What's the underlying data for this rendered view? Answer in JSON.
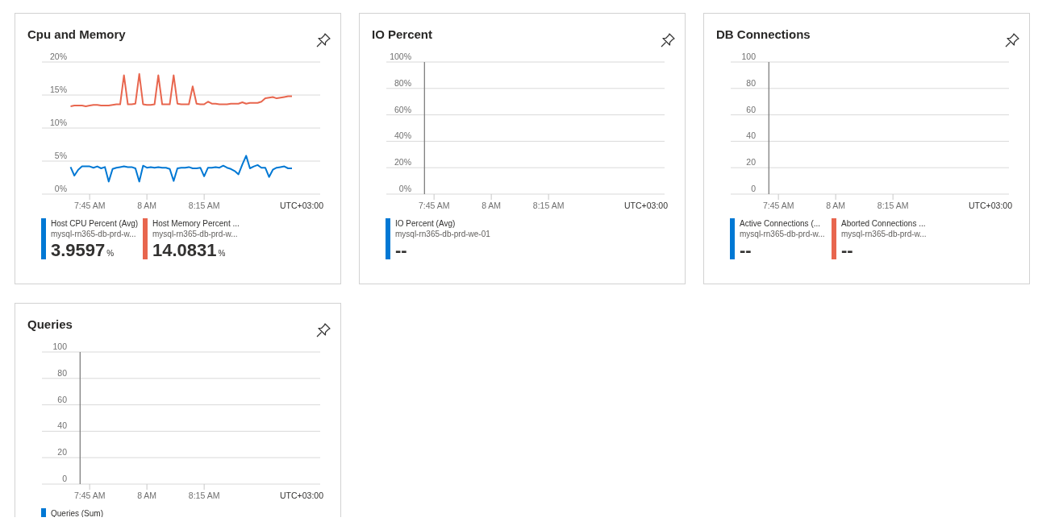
{
  "cards": [
    {
      "title": "Cpu and Memory",
      "chart_data": {
        "type": "line",
        "categories": [
          null,
          null,
          null,
          null,
          null,
          "7:45 AM",
          null,
          null,
          null,
          null,
          null,
          null,
          null,
          null,
          null,
          null,
          null,
          null,
          null,
          null,
          "8 AM",
          null,
          null,
          null,
          null,
          null,
          null,
          null,
          null,
          null,
          null,
          null,
          null,
          null,
          null,
          "8:15 AM",
          null,
          null,
          null,
          null,
          null,
          null,
          null,
          null,
          null,
          null,
          null,
          null,
          null,
          null,
          null,
          null,
          null,
          null,
          null,
          null,
          null,
          null,
          null
        ],
        "ylim": [
          0,
          20
        ],
        "grid": true,
        "xlabel": "UTC+03:00",
        "yticks": [
          {
            "value": 0,
            "label": "0%"
          },
          {
            "value": 5,
            "label": "5%"
          },
          {
            "value": 10,
            "label": "10%"
          },
          {
            "value": 15,
            "label": "15%"
          },
          {
            "value": 20,
            "label": "20%"
          }
        ],
        "series": [
          {
            "name": "Host CPU Percent (Avg)",
            "color": "#0078d4",
            "values": [
              4.1,
              2.8,
              3.7,
              4.2,
              4.2,
              4.2,
              4.0,
              4.2,
              3.9,
              4.1,
              1.9,
              3.8,
              4.0,
              4.1,
              4.2,
              4.1,
              4.1,
              3.9,
              1.9,
              4.3,
              4.0,
              4.1,
              4.0,
              4.1,
              4.0,
              4.0,
              3.8,
              2.0,
              3.9,
              4.0,
              4.0,
              4.1,
              3.9,
              3.9,
              4.0,
              2.7,
              4.0,
              4.0,
              4.1,
              4.0,
              4.3,
              4.0,
              3.8,
              3.5,
              3.0,
              4.5,
              5.8,
              3.9,
              4.2,
              4.4,
              4.0,
              4.0,
              2.6,
              3.7,
              4.0,
              4.1,
              4.2,
              3.9,
              3.9
            ]
          },
          {
            "name": "Host Memory Percent ...",
            "color": "#e8664e",
            "values": [
              13.3,
              13.4,
              13.4,
              13.4,
              13.3,
              13.4,
              13.5,
              13.5,
              13.4,
              13.4,
              13.4,
              13.5,
              13.6,
              13.6,
              18.0,
              13.6,
              13.6,
              13.7,
              18.2,
              13.6,
              13.5,
              13.5,
              13.6,
              18.0,
              13.6,
              13.6,
              13.6,
              18.0,
              13.7,
              13.6,
              13.6,
              13.6,
              16.3,
              13.7,
              13.6,
              13.6,
              14.0,
              13.7,
              13.7,
              13.6,
              13.6,
              13.6,
              13.7,
              13.7,
              13.7,
              13.9,
              13.7,
              13.8,
              13.8,
              13.8,
              14.0,
              14.5,
              14.6,
              14.7,
              14.5,
              14.6,
              14.7,
              14.8,
              14.8
            ]
          }
        ]
      },
      "legend": [
        {
          "resource": "mysql-rn365-db-prd-w...",
          "value": "3.9597",
          "unit": "%",
          "color": "#0078d4"
        },
        {
          "resource": "mysql-rn365-db-prd-w...",
          "value": "14.0831",
          "unit": "%",
          "color": "#e8664e"
        }
      ]
    },
    {
      "title": "IO Percent",
      "chart_data": {
        "type": "line",
        "categories": [
          null,
          null,
          null,
          null,
          null,
          "7:45 AM",
          null,
          null,
          null,
          null,
          null,
          null,
          null,
          null,
          null,
          null,
          null,
          null,
          null,
          null,
          "8 AM",
          null,
          null,
          null,
          null,
          null,
          null,
          null,
          null,
          null,
          null,
          null,
          null,
          null,
          null,
          "8:15 AM",
          null,
          null,
          null,
          null,
          null,
          null,
          null,
          null,
          null,
          null,
          null,
          null,
          null,
          null,
          null,
          null,
          null,
          null,
          null,
          null,
          null,
          null,
          null
        ],
        "ylim": [
          0,
          100
        ],
        "grid": true,
        "xlabel": "UTC+03:00",
        "yticks": [
          {
            "value": 0,
            "label": "0%"
          },
          {
            "value": 20,
            "label": "20%"
          },
          {
            "value": 40,
            "label": "40%"
          },
          {
            "value": 60,
            "label": "60%"
          },
          {
            "value": 80,
            "label": "80%"
          },
          {
            "value": 100,
            "label": "100%"
          }
        ]
      },
      "legend": [
        {
          "name": "IO Percent (Avg)",
          "resource": "mysql-rn365-db-prd-we-01",
          "value": "--",
          "color": "#0078d4"
        }
      ]
    },
    {
      "title": "DB Connections",
      "chart_data": {
        "type": "line",
        "categories": [
          null,
          null,
          null,
          null,
          null,
          "7:45 AM",
          null,
          null,
          null,
          null,
          null,
          null,
          null,
          null,
          null,
          null,
          null,
          null,
          null,
          null,
          "8 AM",
          null,
          null,
          null,
          null,
          null,
          null,
          null,
          null,
          null,
          null,
          null,
          null,
          null,
          null,
          "8:15 AM",
          null,
          null,
          null,
          null,
          null,
          null,
          null,
          null,
          null,
          null,
          null,
          null,
          null,
          null,
          null,
          null,
          null,
          null,
          null,
          null,
          null,
          null,
          null
        ],
        "ylim": [
          0,
          100
        ],
        "grid": true,
        "xlabel": "UTC+03:00",
        "yticks": [
          {
            "value": 0,
            "label": "0"
          },
          {
            "value": 20,
            "label": "20"
          },
          {
            "value": 40,
            "label": "40"
          },
          {
            "value": 60,
            "label": "60"
          },
          {
            "value": 80,
            "label": "80"
          },
          {
            "value": 100,
            "label": "100"
          }
        ]
      },
      "legend": [
        {
          "name": "Active Connections (...",
          "resource": "mysql-rn365-db-prd-w...",
          "value": "--",
          "color": "#0078d4"
        },
        {
          "name": "Aborted Connections ...",
          "resource": "mysql-rn365-db-prd-w...",
          "value": "--",
          "color": "#e8664e"
        }
      ]
    },
    {
      "title": "Queries",
      "chart_data": {
        "type": "line",
        "categories": [
          null,
          null,
          null,
          null,
          null,
          "7:45 AM",
          null,
          null,
          null,
          null,
          null,
          null,
          null,
          null,
          null,
          null,
          null,
          null,
          null,
          null,
          "8 AM",
          null,
          null,
          null,
          null,
          null,
          null,
          null,
          null,
          null,
          null,
          null,
          null,
          null,
          null,
          "8:15 AM",
          null,
          null,
          null,
          null,
          null,
          null,
          null,
          null,
          null,
          null,
          null,
          null,
          null,
          null,
          null,
          null,
          null,
          null,
          null,
          null,
          null,
          null,
          null
        ],
        "ylim": [
          0,
          100
        ],
        "grid": true,
        "xlabel": "UTC+03:00",
        "yticks": [
          {
            "value": 0,
            "label": "0"
          },
          {
            "value": 20,
            "label": "20"
          },
          {
            "value": 40,
            "label": "40"
          },
          {
            "value": 60,
            "label": "60"
          },
          {
            "value": 80,
            "label": "80"
          },
          {
            "value": 100,
            "label": "100"
          }
        ]
      },
      "legend": [
        {
          "name": "Queries (Sum)",
          "color": "#0078d4"
        }
      ]
    }
  ]
}
